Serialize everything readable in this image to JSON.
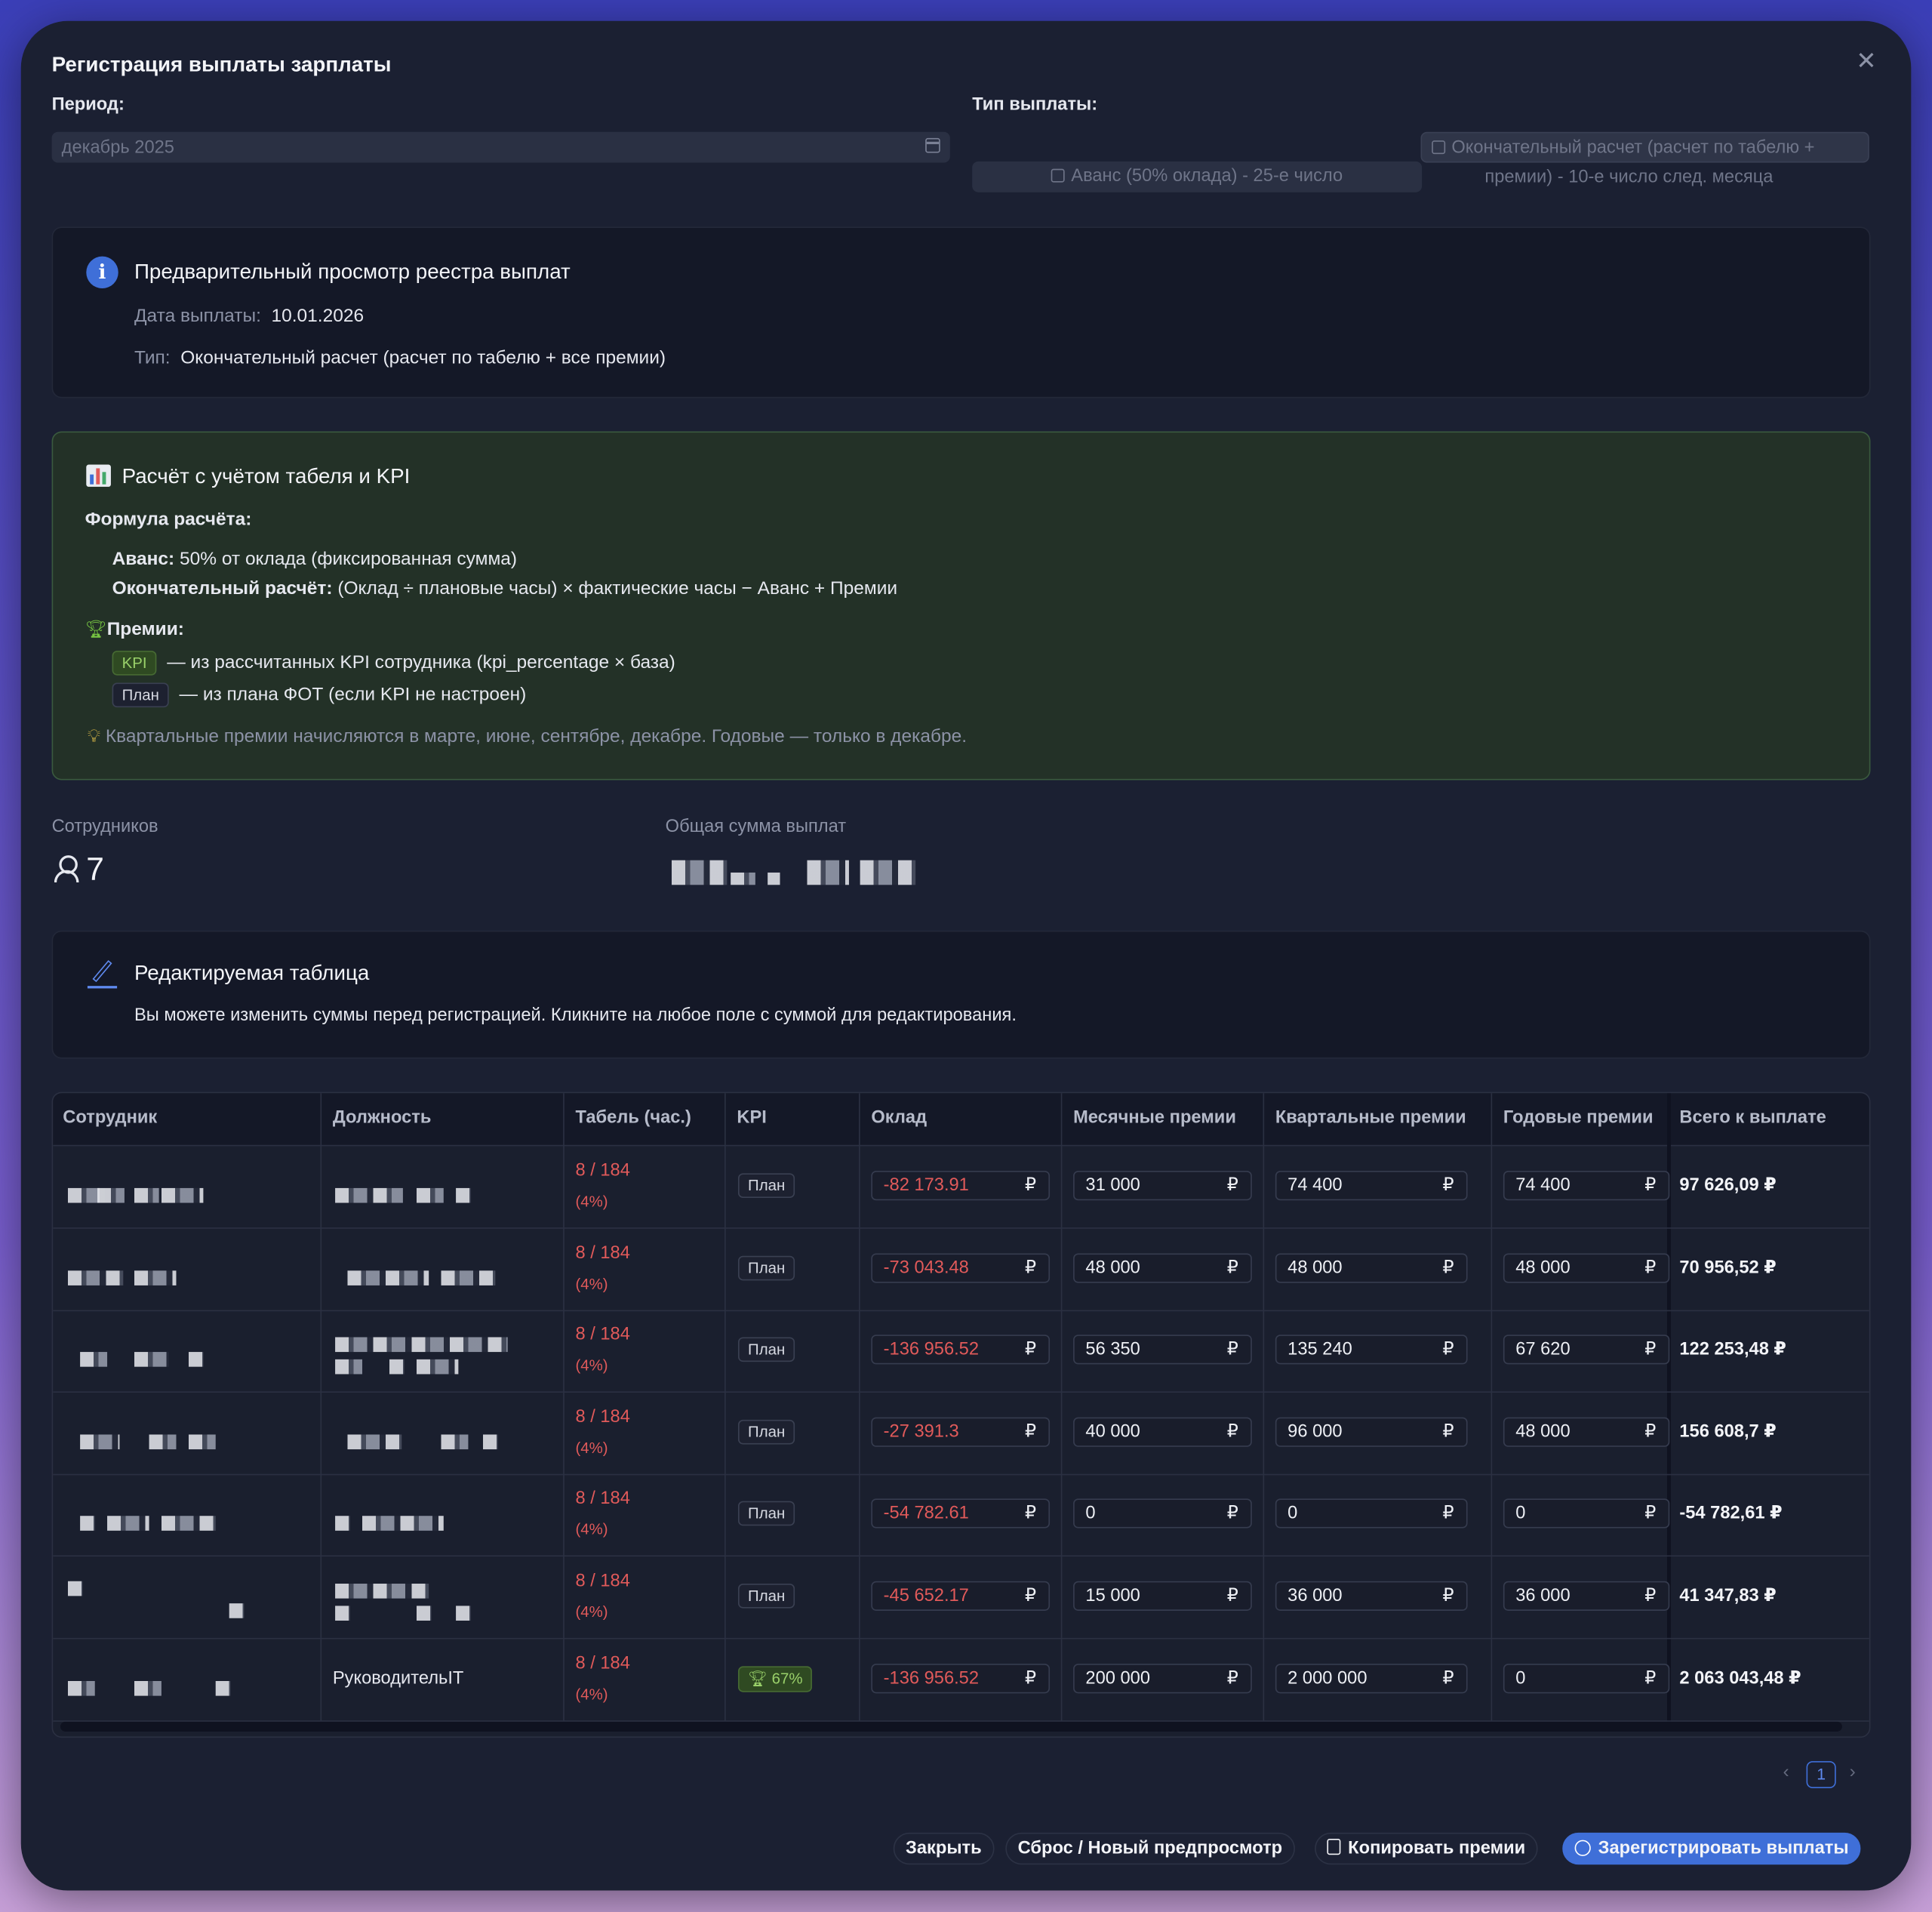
{
  "dialog": {
    "title": "Регистрация выплаты зарплаты",
    "period_label": "Период:",
    "period_value": "декабрь 2025",
    "type_label": "Тип выплаты:",
    "type_option_1": "Аванс (50% оклада) - 25-е число",
    "type_option_2_line1": "Окончательный расчет (расчет по табелю +",
    "type_option_2_line2": "премии) - 10-е число след. месяца"
  },
  "preview": {
    "title": "Предварительный просмотр реестра выплат",
    "date_label": "Дата выплаты",
    "date_value": "10.01.2026",
    "type_label": "Тип",
    "type_value": "Окончательный расчет (расчет по табелю + все премии)"
  },
  "calc": {
    "title": "Расчёт с учётом табеля и KPI",
    "formula_label": "Формула расчёта:",
    "advance_label": "Аванс:",
    "advance_text": "50% от оклада (фиксированная сумма)",
    "final_label": "Окончательный расчёт:",
    "final_text": "(Оклад ÷ плановые часы) × фактические часы − Аванс + Премии",
    "bonus_label": "Премии:",
    "kpi_tag": "KPI",
    "kpi_text": "— из рассчитанных KPI сотрудника (kpi_percentage × база)",
    "plan_tag": "План",
    "plan_text": "— из плана ФОТ (если KPI не настроен)",
    "note": "Квартальные премии начисляются в марте, июне, сентябре, декабре. Годовые — только в декабре."
  },
  "stats": {
    "employees_label": "Сотрудников",
    "employees_value": "7",
    "total_label": "Общая сумма выплат"
  },
  "editable": {
    "title": "Редактируемая таблица",
    "text": "Вы можете изменить суммы перед регистрацией. Кликните на любое поле с суммой для редактирования."
  },
  "table": {
    "headers": [
      "Сотрудник",
      "Должность",
      "Табель (час.)",
      "KPI",
      "Оклад",
      "Месячные премии",
      "Квартальные премии",
      "Годовые премии",
      "Всего к выплате"
    ],
    "currency": "₽",
    "rows": [
      {
        "position": "",
        "hours": "8 / 184",
        "pct": "(4%)",
        "kpi": "План",
        "salary": "-82 173.91",
        "monthly": "31 000",
        "quarterly": "74 400",
        "yearly": "74 400",
        "total": "97 626,09 ₽"
      },
      {
        "position": "",
        "hours": "8 / 184",
        "pct": "(4%)",
        "kpi": "План",
        "salary": "-73 043.48",
        "monthly": "48 000",
        "quarterly": "48 000",
        "yearly": "48 000",
        "total": "70 956,52 ₽"
      },
      {
        "position": "",
        "hours": "8 / 184",
        "pct": "(4%)",
        "kpi": "План",
        "salary": "-136 956.52",
        "monthly": "56 350",
        "quarterly": "135 240",
        "yearly": "67 620",
        "total": "122 253,48 ₽"
      },
      {
        "position": "",
        "hours": "8 / 184",
        "pct": "(4%)",
        "kpi": "План",
        "salary": "-27 391.3",
        "monthly": "40 000",
        "quarterly": "96 000",
        "yearly": "48 000",
        "total": "156 608,7 ₽"
      },
      {
        "position": "",
        "hours": "8 / 184",
        "pct": "(4%)",
        "kpi": "План",
        "salary": "-54 782.61",
        "monthly": "0",
        "quarterly": "0",
        "yearly": "0",
        "total": "-54 782,61 ₽"
      },
      {
        "position": "",
        "hours": "8 / 184",
        "pct": "(4%)",
        "kpi": "План",
        "salary": "-45 652.17",
        "monthly": "15 000",
        "quarterly": "36 000",
        "yearly": "36 000",
        "total": "41 347,83 ₽"
      },
      {
        "position": "РуководительIT",
        "hours": "8 / 184",
        "pct": "(4%)",
        "kpi": "67%",
        "salary": "-136 956.52",
        "monthly": "200 000",
        "quarterly": "2 000 000",
        "yearly": "0",
        "total": "2 063 043,48 ₽"
      }
    ]
  },
  "pagination": {
    "current": "1"
  },
  "buttons": {
    "close": "Закрыть",
    "reset": "Сброс / Новый предпросмотр",
    "copy": "Копировать премии",
    "register": "Зарегистрировать выплаты"
  }
}
